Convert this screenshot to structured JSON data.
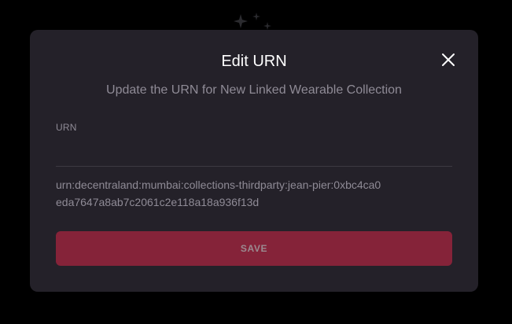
{
  "modal": {
    "title": "Edit URN",
    "subtitle": "Update the URN for New Linked Wearable Collection",
    "close_icon": "close-icon"
  },
  "form": {
    "urn_label": "URN",
    "urn_value": "",
    "urn_preview": "urn:decentraland:mumbai:collections-thirdparty:jean-pier:0xbc4ca0eda7647a8ab7c2061c2e118a18a936f13d",
    "save_label": "SAVE"
  },
  "colors": {
    "modal_background": "#242129",
    "save_button": "#852339",
    "muted_text": "#8f8b96"
  }
}
